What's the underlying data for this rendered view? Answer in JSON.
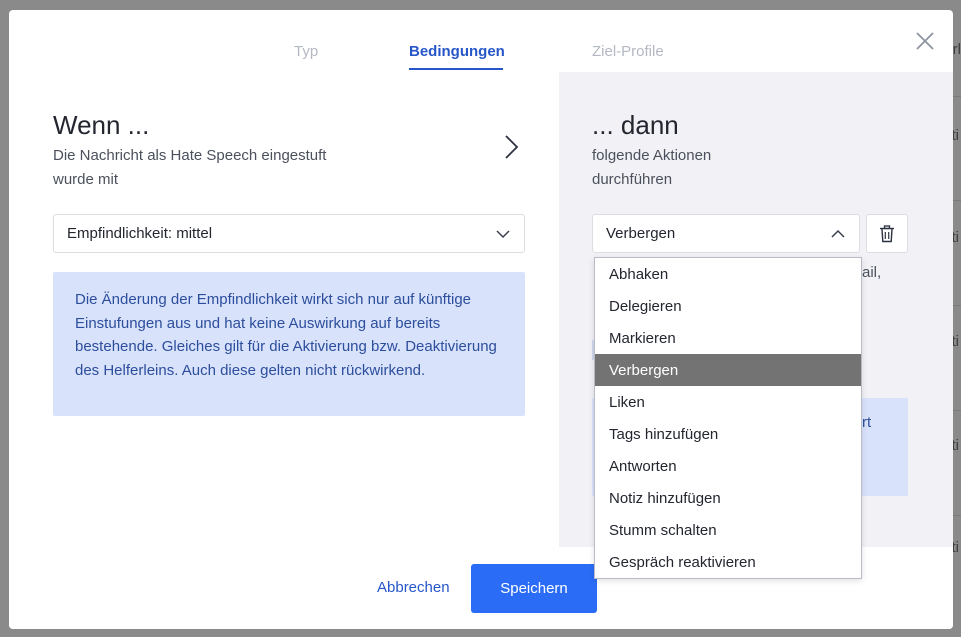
{
  "background": {
    "fragments": [
      "rl",
      "ti",
      "ti",
      "ti",
      "ti",
      "ti"
    ]
  },
  "tabs": [
    {
      "label": "Typ",
      "active": false
    },
    {
      "label": "Bedingungen",
      "active": true
    },
    {
      "label": "Ziel-Profile",
      "active": false
    }
  ],
  "condition": {
    "title": "Wenn ...",
    "subtitle_line1": "Die Nachricht als Hate Speech eingestuft",
    "subtitle_line2": "wurde mit",
    "sensitivity_select": "Empfindlichkeit: mittel",
    "info_text": "Die Änderung der Empfindlichkeit wirkt sich nur auf künftige Einstufungen aus und hat keine Auswirkung auf bereits bestehende. Gleiches gilt für die Aktivierung bzw. Deaktivierung des Helferleins. Auch diese gelten nicht rückwirkend."
  },
  "action": {
    "title": "... dann",
    "subtitle_line1": "folgende Aktionen",
    "subtitle_line2": "durchführen",
    "action_select": "Verbergen",
    "peek_text_1": "ail,",
    "peek_text_2": "rt",
    "options": [
      "Abhaken",
      "Delegieren",
      "Markieren",
      "Verbergen",
      "Liken",
      "Tags hinzufügen",
      "Antworten",
      "Notiz hinzufügen",
      "Stumm schalten",
      "Gespräch reaktivieren"
    ],
    "selected_option": "Verbergen"
  },
  "footer": {
    "cancel_label": "Abbrechen",
    "save_label": "Speichern"
  },
  "colors": {
    "accent": "#2656c8",
    "primary_button": "#2b6cf6",
    "info_bg": "#d8e2fb",
    "selected_item_bg": "#737373"
  }
}
